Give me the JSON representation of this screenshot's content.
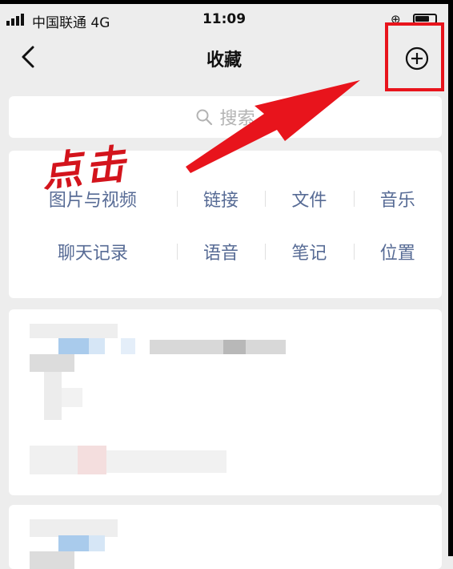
{
  "status_bar": {
    "carrier": "中国联通  4G",
    "time": "11:09",
    "lock_icon": "rotation-lock-icon",
    "battery_level": 0.7
  },
  "nav": {
    "title": "收藏",
    "back_icon": "chevron-left-icon",
    "add_icon": "plus-circle-icon"
  },
  "search": {
    "placeholder": "搜索",
    "icon": "search-icon"
  },
  "categories": {
    "row1": [
      "图片与视频",
      "链接",
      "文件",
      "音乐"
    ],
    "row2": [
      "聊天记录",
      "语音",
      "笔记",
      "位置"
    ]
  },
  "annotation": {
    "text": "点击",
    "color": "#e8141c"
  },
  "colors": {
    "accent_link": "#576b95",
    "background": "#ededed",
    "highlight": "#e8141c"
  }
}
